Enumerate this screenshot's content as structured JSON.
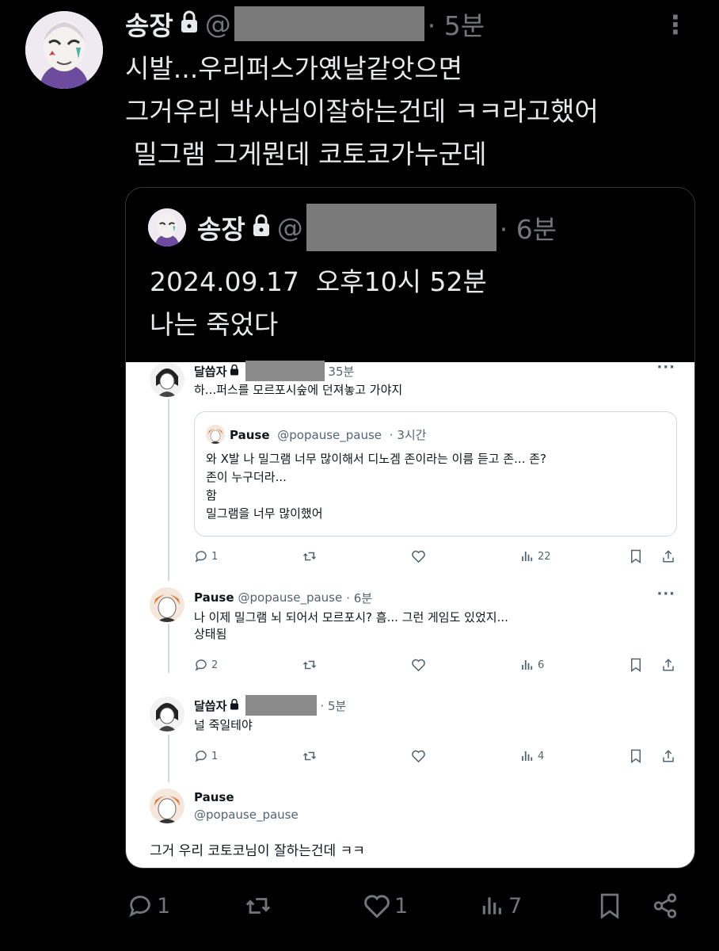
{
  "tweet": {
    "author_name": "송장",
    "handle_prefix": "@",
    "time": "· 5분",
    "more": "⋮",
    "lines": [
      "시발...우리퍼스가옜날같앗으면",
      "그거우리 박사님이잘하는건데 ㅋㅋ라고했어",
      " 밀그램 그게뭔데 코토코가누군데"
    ]
  },
  "quote": {
    "author_name": "송장",
    "handle_prefix": "@",
    "time": "· 6분",
    "lines": [
      "2024.09.17  오후10시 52분",
      "나는 죽었다"
    ]
  },
  "screenshot": {
    "post1": {
      "name": "달씁자",
      "time": "35분",
      "text": "하...퍼스를 모르포시숲에 던져놓고 가야지",
      "quoted": {
        "name": "Pause",
        "handle": "@popause_pause",
        "time": "· 3시간",
        "lines": [
          "와 X발 나 밀그램 너무 많이해서 디노겜 존이라는 이름 듣고 존... 존?",
          "존이 누구더라...",
          "함",
          "밀그램을 너무 많이했어"
        ]
      },
      "replies": "1",
      "views": "22"
    },
    "post2": {
      "name": "Pause",
      "handle": "@popause_pause",
      "time": "· 6분",
      "lines": [
        "나 이제 밀그램 뇌 되어서 모르포시? 흠... 그런 게임도 있었지...",
        "상태됨"
      ],
      "replies": "2",
      "views": "6"
    },
    "post3": {
      "name": "달씁자",
      "time": "· 5분",
      "text": "널 죽일테야",
      "replies": "1",
      "views": "4"
    },
    "post4": {
      "name": "Pause",
      "handle": "@popause_pause",
      "text": "그거 우리 코토코님이 잘하는건데 ㅋㅋ"
    }
  },
  "bottom_bar": {
    "replies": "1",
    "likes": "1",
    "views": "7"
  },
  "colors": {
    "background": "#000000",
    "text": "#e7e9ea",
    "muted": "#71767b",
    "redaction": "#7a7a7a"
  },
  "icons": [
    "lock-icon",
    "reply-icon",
    "retweet-icon",
    "like-icon",
    "views-icon",
    "bookmark-icon",
    "share-icon",
    "more-icon"
  ]
}
